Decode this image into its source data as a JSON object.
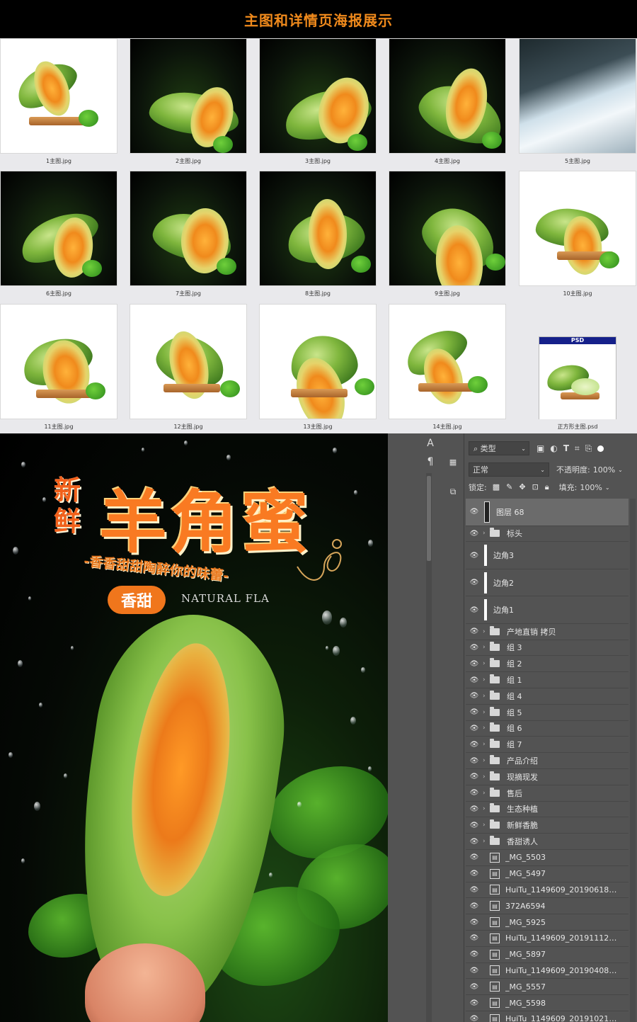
{
  "header": {
    "title": "主图和详情页海报展示"
  },
  "thumbnails": [
    {
      "label": "1主图.jpg",
      "style": "white"
    },
    {
      "label": "2主图.jpg",
      "style": "dark"
    },
    {
      "label": "3主图.jpg",
      "style": "dark"
    },
    {
      "label": "4主图.jpg",
      "style": "dark"
    },
    {
      "label": "5主图.jpg",
      "style": "water"
    },
    {
      "label": "6主图.jpg",
      "style": "dark"
    },
    {
      "label": "7主图.jpg",
      "style": "dark"
    },
    {
      "label": "8主图.jpg",
      "style": "dark"
    },
    {
      "label": "9主图.jpg",
      "style": "dark"
    },
    {
      "label": "10主图.jpg",
      "style": "white"
    },
    {
      "label": "11主图.jpg",
      "style": "white"
    },
    {
      "label": "12主图.jpg",
      "style": "white"
    },
    {
      "label": "13主图.jpg",
      "style": "white"
    },
    {
      "label": "14主图.jpg",
      "style": "white"
    },
    {
      "label": "正方形主图.psd",
      "style": "psd",
      "badge": "PSD"
    }
  ],
  "poster": {
    "title_small": "新鲜",
    "title_big": "羊角蜜",
    "slogan": "-香香甜甜陶醉你的味蕾-",
    "badge": "香甜",
    "english": "NATURAL FLA"
  },
  "photoshop": {
    "filter": {
      "label": "类型"
    },
    "blend": {
      "mode": "正常",
      "opacity_label": "不透明度:",
      "opacity_value": "100%"
    },
    "lock": {
      "label": "锁定:",
      "fill_label": "填充:",
      "fill_value": "100%"
    },
    "layers": [
      {
        "name": "图层 68",
        "type": "pixel",
        "selected": true,
        "tall": true
      },
      {
        "name": "标头",
        "type": "group"
      },
      {
        "name": "边角3",
        "type": "pixel",
        "tall": true
      },
      {
        "name": "边角2",
        "type": "pixel",
        "tall": true
      },
      {
        "name": "边角1",
        "type": "pixel",
        "tall": true
      },
      {
        "name": "产地直销 拷贝",
        "type": "group"
      },
      {
        "name": "组 3",
        "type": "group"
      },
      {
        "name": "组 2",
        "type": "group"
      },
      {
        "name": "组 1",
        "type": "group"
      },
      {
        "name": "组 4",
        "type": "group"
      },
      {
        "name": "组 5",
        "type": "group"
      },
      {
        "name": "组 6",
        "type": "group"
      },
      {
        "name": "组 7",
        "type": "group"
      },
      {
        "name": "产品介绍",
        "type": "group"
      },
      {
        "name": "现摘现发",
        "type": "group"
      },
      {
        "name": "售后",
        "type": "group"
      },
      {
        "name": "生态种植",
        "type": "group"
      },
      {
        "name": "新鲜香脆",
        "type": "group"
      },
      {
        "name": "香甜诱人",
        "type": "group"
      },
      {
        "name": "_MG_5503",
        "type": "smart"
      },
      {
        "name": "_MG_5497",
        "type": "smart"
      },
      {
        "name": "HuiTu_1149609_201906181...",
        "type": "smart"
      },
      {
        "name": "372A6594",
        "type": "smart"
      },
      {
        "name": "_MG_5925",
        "type": "smart"
      },
      {
        "name": "HuiTu_1149609_201911120...",
        "type": "smart"
      },
      {
        "name": "_MG_5897",
        "type": "smart"
      },
      {
        "name": "HuiTu_1149609_201904081...",
        "type": "smart"
      },
      {
        "name": "_MG_5557",
        "type": "smart"
      },
      {
        "name": "_MG_5598",
        "type": "smart"
      },
      {
        "name": "HuiTu_1149609_201910211...",
        "type": "smart"
      }
    ]
  },
  "colors": {
    "accent": "#f08a1c",
    "panel_bg": "#535353",
    "selected_row": "#6b6b6b"
  }
}
